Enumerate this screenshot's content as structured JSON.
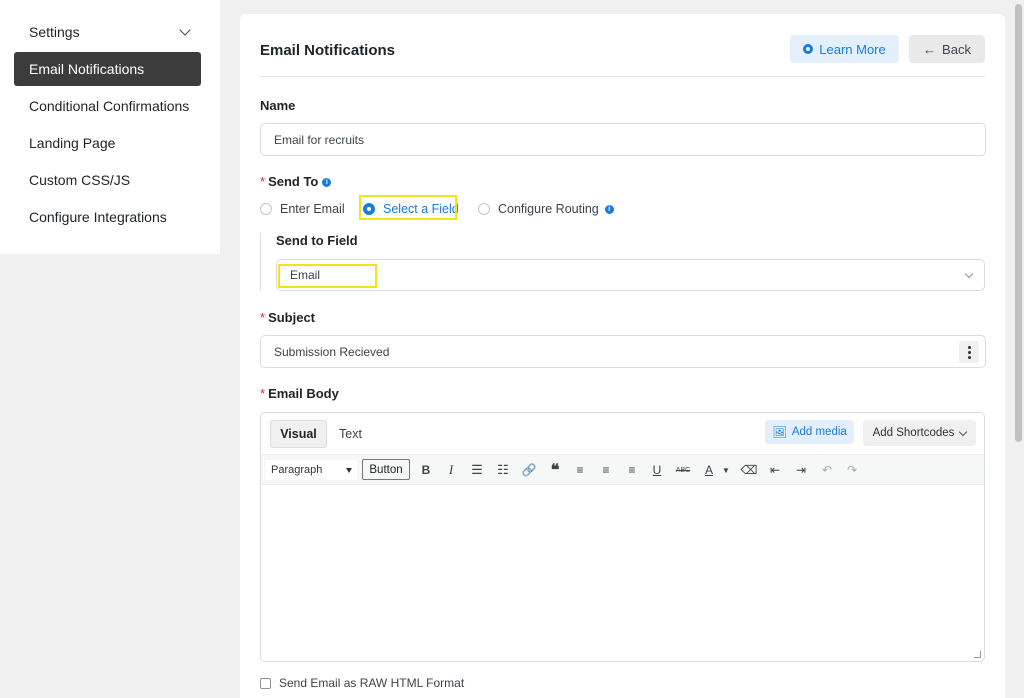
{
  "sidebar": {
    "settings_label": "Settings",
    "items": [
      {
        "label": "Email Notifications",
        "active": true
      },
      {
        "label": "Conditional Confirmations"
      },
      {
        "label": "Landing Page"
      },
      {
        "label": "Custom CSS/JS"
      },
      {
        "label": "Configure Integrations"
      }
    ]
  },
  "header": {
    "title": "Email Notifications",
    "learn_more": "Learn More",
    "back": "Back"
  },
  "form": {
    "name_label": "Name",
    "name_value": "Email for recruits",
    "send_to_label": "Send To",
    "send_to_options": [
      "Enter Email",
      "Select a Field",
      "Configure Routing"
    ],
    "send_to_selected": "Select a Field",
    "send_to_field_label": "Send to Field",
    "send_to_field_value": "Email",
    "subject_label": "Subject",
    "subject_value": "Submission Recieved",
    "email_body_label": "Email Body",
    "raw_html_label": "Send Email as RAW HTML Format"
  },
  "editor": {
    "tab_visual": "Visual",
    "tab_text": "Text",
    "add_media": "Add media",
    "add_shortcodes": "Add Shortcodes",
    "format_select": "Paragraph",
    "button_label": "Button",
    "toolbar_icons": [
      "bold-icon",
      "italic-icon",
      "bullet-list-icon",
      "numbered-list-icon",
      "link-icon",
      "blockquote-icon",
      "align-left-icon",
      "align-center-icon",
      "align-right-icon",
      "underline-icon",
      "strikethrough-icon",
      "text-color-icon",
      "clear-format-icon",
      "outdent-icon",
      "indent-icon",
      "undo-icon",
      "redo-icon"
    ]
  },
  "colors": {
    "accent": "#1a7be0",
    "active_sidebar": "#3c3c3c",
    "highlight": "#f1e31f",
    "required": "#d63638"
  }
}
